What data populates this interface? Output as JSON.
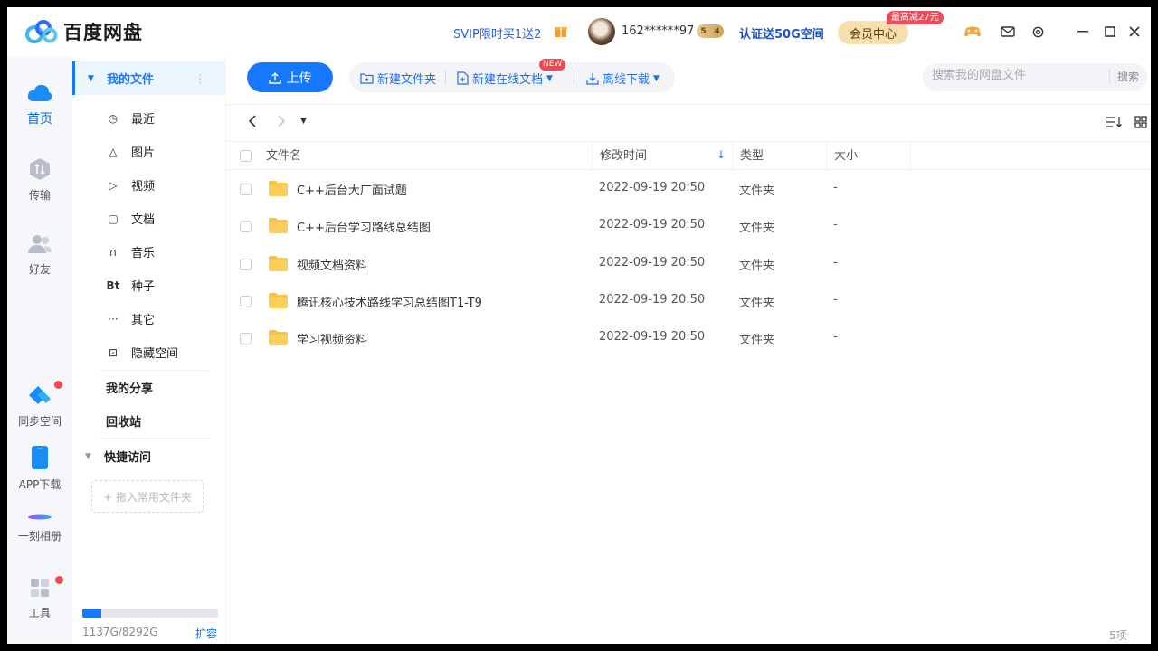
{
  "app": {
    "title": "百度网盘"
  },
  "header": {
    "svip_promo": "SVIP限时买1送2",
    "username": "162******97",
    "vip_level_left": "5",
    "vip_level_right": "4",
    "verify_promo": "认证送50G空间",
    "member_center": "会员中心",
    "promo_badge": "最高减27元"
  },
  "leftnav": {
    "items": [
      {
        "label": "首页",
        "icon": "cloud-icon",
        "active": true
      },
      {
        "label": "传输",
        "icon": "transfer-icon"
      },
      {
        "label": "好友",
        "icon": "friends-icon"
      },
      {
        "label": "同步空间",
        "icon": "sync-icon"
      },
      {
        "label": "APP下载",
        "icon": "phone-icon"
      },
      {
        "label": "一刻相册",
        "icon": "album-icon"
      },
      {
        "label": "工具",
        "icon": "tools-icon"
      }
    ]
  },
  "sidebar": {
    "my_files": "我的文件",
    "items": [
      {
        "label": "最近",
        "icon": "clock-icon",
        "glyph": "◷"
      },
      {
        "label": "图片",
        "icon": "image-icon",
        "glyph": "△"
      },
      {
        "label": "视频",
        "icon": "play-icon",
        "glyph": "▷"
      },
      {
        "label": "文档",
        "icon": "document-icon",
        "glyph": "▢"
      },
      {
        "label": "音乐",
        "icon": "headphone-icon",
        "glyph": "∩"
      },
      {
        "label": "种子",
        "icon": "bt-icon",
        "glyph": "Bt"
      },
      {
        "label": "其它",
        "icon": "more-icon",
        "glyph": "···"
      },
      {
        "label": "隐藏空间",
        "icon": "lock-icon",
        "glyph": "⊡"
      }
    ],
    "my_share": "我的分享",
    "recycle_bin": "回收站",
    "quick_access": "快捷访问",
    "drop_hint": "+ 拖入常用文件夹",
    "storage": {
      "used_gb": 1137,
      "total_gb": 8292,
      "text": "1137G/8292G",
      "expand": "扩容"
    }
  },
  "toolbar": {
    "upload": "上传",
    "new_folder": "新建文件夹",
    "new_online_doc": "新建在线文档",
    "new_badge": "NEW",
    "offline_download": "离线下载",
    "search_placeholder": "搜索我的网盘文件",
    "search_button": "搜索"
  },
  "table": {
    "columns": {
      "name": "文件名",
      "modified": "修改时间",
      "type": "类型",
      "size": "大小"
    },
    "rows": [
      {
        "name": "C++后台大厂面试题",
        "modified": "2022-09-19 20:50",
        "type": "文件夹",
        "size": "-"
      },
      {
        "name": "C++后台学习路线总结图",
        "modified": "2022-09-19 20:50",
        "type": "文件夹",
        "size": "-"
      },
      {
        "name": "视频文档资料",
        "modified": "2022-09-19 20:50",
        "type": "文件夹",
        "size": "-"
      },
      {
        "name": "腾讯核心技术路线学习总结图T1-T9",
        "modified": "2022-09-19 20:50",
        "type": "文件夹",
        "size": "-"
      },
      {
        "name": "学习视频资料",
        "modified": "2022-09-19 20:50",
        "type": "文件夹",
        "size": "-"
      }
    ],
    "count": "5项"
  },
  "colors": {
    "accent": "#1677ff",
    "folder": "#f7c343",
    "sidebar_active_bg": "#edf5ff"
  }
}
